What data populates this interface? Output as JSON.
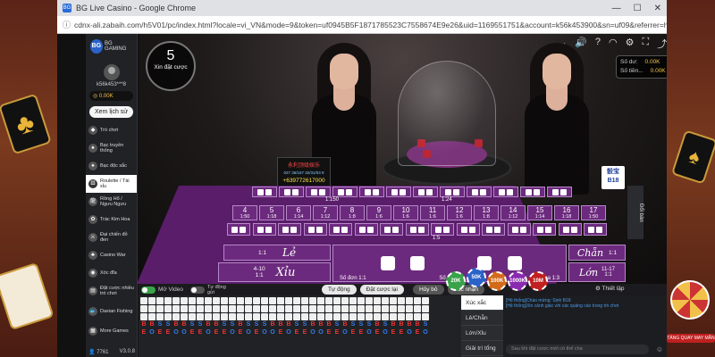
{
  "window": {
    "title": "BG Live Casino - Google Chrome",
    "url": "cdnx-ali.zabaih.com/h5V01/pc/index.html?locale=vi_VN&mode=9&token=uf0945B5F1871785523C7558674E9e26&uid=1169551751&account=k56k453900&sn=uf09&referrer=https://new8815.cc..."
  },
  "sidebar": {
    "logo": "BG GAMING",
    "username": "k56k453***8",
    "balance": "0.00K",
    "history_button": "Xem lịch sử",
    "items": [
      {
        "label": "Trò chơi",
        "icon": "gamepad-icon"
      },
      {
        "label": "Bạc truyền thống",
        "icon": "cards-icon"
      },
      {
        "label": "Bạc độc sắc",
        "icon": "cards-icon"
      },
      {
        "label": "Roulette / Tài xỉu",
        "icon": "dice-icon"
      },
      {
        "label": "Rồng Hổ / Ngưu Ngưu",
        "icon": "dragon-icon"
      },
      {
        "label": "Trác Kim Hoa",
        "icon": "flower-icon"
      },
      {
        "label": "Đại chiến đỏ đen",
        "icon": "swords-icon"
      },
      {
        "label": "Casino War",
        "icon": "casino-icon"
      },
      {
        "label": "Xóc đĩa",
        "icon": "disc-icon"
      },
      {
        "label": "Đặt cược nhiều trò chơi",
        "icon": "multi-icon"
      }
    ],
    "extra": [
      "Daxian Fishing",
      "More Games"
    ],
    "online_count": "7761",
    "version": "V3.0.8"
  },
  "video": {
    "timer_value": "5",
    "timer_label": "Xin đặt cược",
    "balance_labels": [
      "Số dư:",
      "Số tiền..."
    ],
    "balance_values": [
      "0.00K",
      "0.00K"
    ],
    "ad_text": "永利顶级娱乐",
    "ad_phone": "+639772617000",
    "ad_small": "027 36/167 32/31/03 9",
    "table_tag": "骰宝 B18"
  },
  "table": {
    "small": "Xỉu",
    "small_odds": "4-10",
    "small_ratio": "1:1",
    "big": "Lớn",
    "big_odds": "11-17",
    "big_ratio": "1:1",
    "odd": "Lẻ",
    "odd_ratio": "1:1",
    "even": "Chẵn",
    "even_ratio": "1:1",
    "triple_ratio": "1:150",
    "pair_ratio": "1:24",
    "sum_ratios": [
      "1:50",
      "1:18",
      "1:14",
      "1:12",
      "1:8",
      "1:6",
      "1:6",
      "1:6",
      "1:6",
      "1:8",
      "1:12",
      "1:14",
      "1:18",
      "1:50"
    ],
    "sum_numbers": [
      "4",
      "5",
      "6",
      "7",
      "8",
      "9",
      "10",
      "11",
      "12",
      "13",
      "14",
      "15",
      "16",
      "17"
    ],
    "combo_ratio": "1:5",
    "single_label": "Số đơn",
    "single_ratio": "1:1",
    "double_label": "Số đôi",
    "double_ratio": "1:2",
    "triple_label": "Số ba",
    "triple_single_ratio": "1:3"
  },
  "controls": {
    "video_toggle": "Mở Video",
    "auto_toggle": "Tự động gửi",
    "buttons": [
      "Tự động",
      "Đặt cược lại",
      "Hủy bỏ",
      "Xác nhận"
    ],
    "chips": [
      "20K",
      "50K",
      "100K",
      "1000K",
      "10M"
    ],
    "settings": "Thiết lập",
    "side_tab": "Đổi bàn"
  },
  "roadmap": {
    "letters": [
      "B",
      "B",
      "S",
      "S",
      "B",
      "B",
      "S",
      "S",
      "B",
      "B",
      "S",
      "S",
      "B",
      "S",
      "S",
      "S",
      "B",
      "B",
      "B",
      "S",
      "S",
      "B",
      "B",
      "B",
      "S",
      "B",
      "S",
      "S",
      "S",
      "B",
      "S",
      "B",
      "B",
      "B",
      "B",
      "S",
      "B",
      "S",
      "S",
      "B",
      "B",
      "S",
      "B",
      "S",
      "S",
      "B"
    ],
    "parity": [
      "E",
      "O",
      "E",
      "E",
      "O",
      "O",
      "E",
      "E",
      "O",
      "E",
      "E",
      "O",
      "E",
      "O",
      "E",
      "O",
      "O",
      "E",
      "O",
      "E",
      "E",
      "O",
      "O",
      "E",
      "E",
      "O",
      "E",
      "E",
      "O",
      "E",
      "O",
      "E",
      "E",
      "O",
      "E",
      "O",
      "E",
      "O",
      "E",
      "E",
      "O",
      "E",
      "O",
      "O",
      "E",
      "O"
    ]
  },
  "tabs": [
    "Xúc xắc",
    "Lẻ/Chẵn",
    "Lớn/Xỉu",
    "Giải trí tổng"
  ],
  "chat": {
    "messages": [
      "[Hệ thống]Chào mừng: Sịnh B18",
      "[Hệ thống]Xin cảnh giác với các quảng cáo trong trò chơi"
    ],
    "placeholder": "Sau khi đặt cược mới có thể cha"
  },
  "right_promo": "TÀNG QUAY MAY MẮN"
}
